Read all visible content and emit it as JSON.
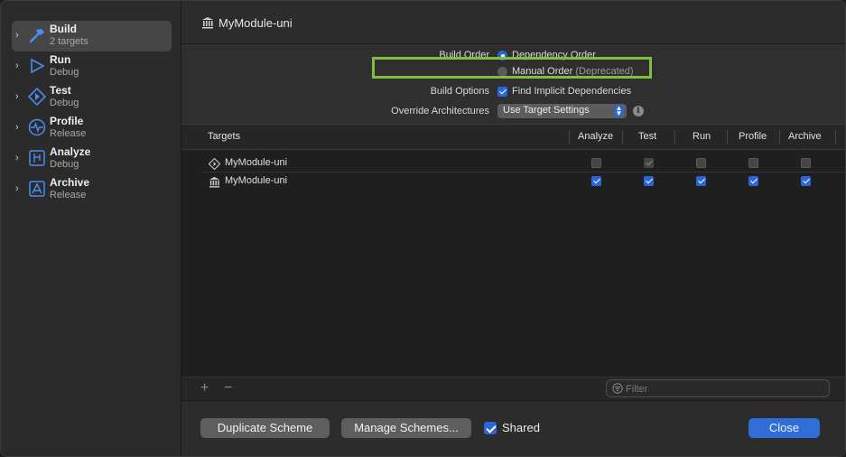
{
  "colors": {
    "accent": "#2b66d7",
    "highlight": "#7fbf3f"
  },
  "sidebar": {
    "items": [
      {
        "name": "Build",
        "sub": "2 targets",
        "icon": "hammer-icon",
        "selected": true
      },
      {
        "name": "Run",
        "sub": "Debug",
        "icon": "play-icon"
      },
      {
        "name": "Test",
        "sub": "Debug",
        "icon": "test-diamond-icon"
      },
      {
        "name": "Profile",
        "sub": "Release",
        "icon": "instruments-icon"
      },
      {
        "name": "Analyze",
        "sub": "Debug",
        "icon": "analyze-icon"
      },
      {
        "name": "Archive",
        "sub": "Release",
        "icon": "archive-icon"
      }
    ]
  },
  "header": {
    "title": "MyModule-uni",
    "icon": "module-icon"
  },
  "options": {
    "build_order_label": "Build Order",
    "dependency_order": "Dependency Order",
    "manual_order": "Manual Order",
    "deprecated": "(Deprecated)",
    "build_options_label": "Build Options",
    "find_implicit": "Find Implicit Dependencies",
    "override_label": "Override Architectures",
    "override_value": "Use Target Settings"
  },
  "table": {
    "columns": [
      "Targets",
      "Analyze",
      "Test",
      "Run",
      "Profile",
      "Archive"
    ],
    "rows": [
      {
        "name": "MyModule-uni",
        "icon": "test-target-icon",
        "checks": [
          false,
          true,
          false,
          false,
          false
        ],
        "test_disabled": true
      },
      {
        "name": "MyModule-uni",
        "icon": "module-icon",
        "checks": [
          true,
          true,
          true,
          true,
          true
        ]
      }
    ]
  },
  "bottombar": {
    "add": "+",
    "remove": "−",
    "filter_placeholder": "Filter"
  },
  "footer": {
    "duplicate": "Duplicate Scheme",
    "manage": "Manage Schemes...",
    "shared": "Shared",
    "close": "Close"
  }
}
